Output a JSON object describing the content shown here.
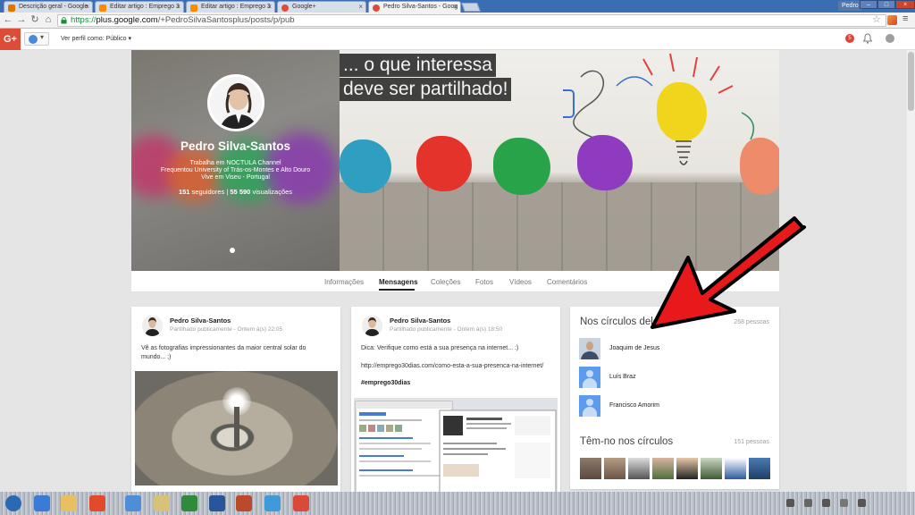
{
  "browser": {
    "tabs": [
      {
        "label": "Descrição geral - Google ",
        "active": false,
        "icon": "analytics-icon",
        "color": "#e37400"
      },
      {
        "label": "Editar artigo : Emprego 3",
        "active": false,
        "icon": "blogger-icon",
        "color": "#ff8a00"
      },
      {
        "label": "Editar artigo : Emprego 3",
        "active": false,
        "icon": "blogger-icon",
        "color": "#ff8a00"
      },
      {
        "label": "Google+",
        "active": false,
        "icon": "gplus-icon",
        "color": "#dd4b39"
      },
      {
        "label": "Pedro Silva-Santos - Goog",
        "active": true,
        "icon": "gplus-icon",
        "color": "#dd4b39"
      }
    ],
    "user_chip": "Pedro",
    "url_scheme": "https://",
    "url_host": "plus.google.com",
    "url_path": "/+PedroSilvaSantosplus/posts/p/pub"
  },
  "gplus_header": {
    "logo": "G+",
    "view_as_label": "Ver perfil como:",
    "view_as_value": "Público",
    "notification_count": "5"
  },
  "profile": {
    "name": "Pedro Silva-Santos",
    "lines": [
      "Trabalha em NOCTULA Channel",
      "Frequentou University of Trás-os-Montes e Alto Douro",
      "Vive em Viseu - Portugal"
    ],
    "followers_count": "151",
    "followers_label": "seguidores",
    "separator": "|",
    "views_count": "55 590",
    "views_label": "visualizações",
    "cover_quote_line1": "... o que interessa",
    "cover_quote_line2": "deve ser partilhado!"
  },
  "profile_tabs": [
    "Informações",
    "Mensagens",
    "Coleções",
    "Fotos",
    "Vídeos",
    "Comentários"
  ],
  "active_tab": "Mensagens",
  "posts": [
    {
      "author": "Pedro Silva-Santos",
      "meta": "Partilhado publicamente  -  Ontem à(s) 22:05",
      "text_line1": "Vê as fotografias impressionantes da maior central solar do",
      "text_line2": "mundo... ;)"
    },
    {
      "author": "Pedro Silva-Santos",
      "meta": "Partilhado publicamente  -  Ontem à(s) 18:50",
      "text_line1": "Dica: Verifique como está a sua presença na internet... :)",
      "link": "http://emprego30dias.com/como-esta-a-sua-presenca-na-internet/",
      "hashtag": "#emprego30dias"
    }
  ],
  "circles": {
    "title": "Nos círculos dele",
    "count": "268 pessoas",
    "people": [
      {
        "name": "Joaquim de Jesus",
        "avatar": "photo"
      },
      {
        "name": "Luís Braz",
        "avatar": "generic"
      },
      {
        "name": "Francisco Amorim",
        "avatar": "generic"
      }
    ],
    "have_title": "Têm-no nos círculos",
    "have_count": "151 pessoas"
  },
  "colors": {
    "gplus_red": "#dd4b39",
    "annotation_arrow": "#e8191a",
    "tab_active_text": "#212121"
  }
}
